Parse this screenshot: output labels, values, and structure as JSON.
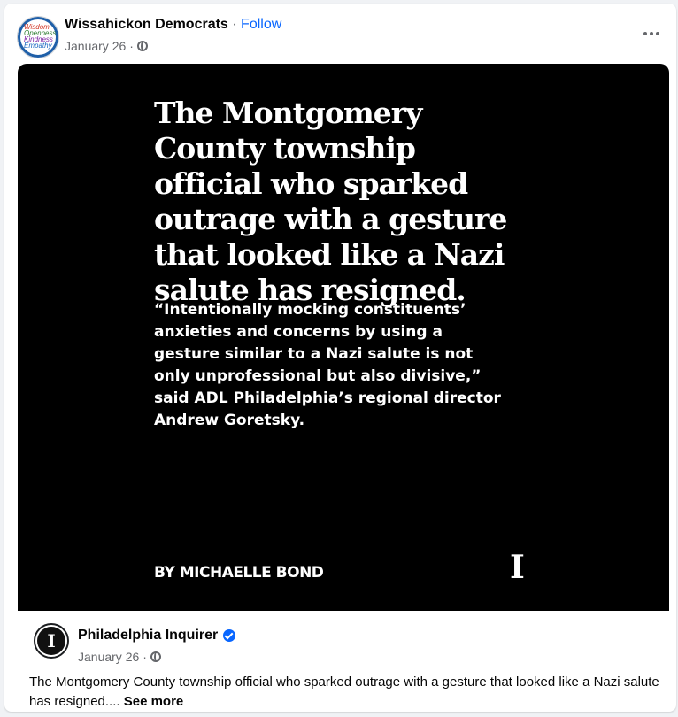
{
  "post": {
    "author": "Wissahickon Democrats",
    "separator": "·",
    "follow_label": "Follow",
    "date": "January 26",
    "meta_sep": "·",
    "avatar_words": [
      "Wisdom",
      "Openness",
      "Kindness",
      "Empathy"
    ]
  },
  "media": {
    "headline": "The Montgomery County township official who sparked outrage with a gesture that looked like a Nazi salute has resigned.",
    "quote": "“Intentionally mocking constituents’ anxieties and concerns by using a gesture similar to a Nazi salute is not only unprofessional but also divisive,” said ADL Philadelphia’s regional director Andrew Goretsky.",
    "byline": "BY MICHAELLE BOND",
    "logo_glyph": "I"
  },
  "shared": {
    "name": "Philadelphia Inquirer",
    "date": "January 26",
    "meta_sep": "·",
    "avatar_glyph": "I",
    "caption": "The Montgomery County township official who sparked outrage with a gesture that looked like a Nazi salute has resigned....",
    "see_more": "See more"
  },
  "colors": {
    "link_blue": "#0866ff",
    "muted_text": "#65676b",
    "media_background": "#000000"
  },
  "icons": [
    "globe-icon",
    "more-options-icon",
    "verified-badge-icon"
  ]
}
